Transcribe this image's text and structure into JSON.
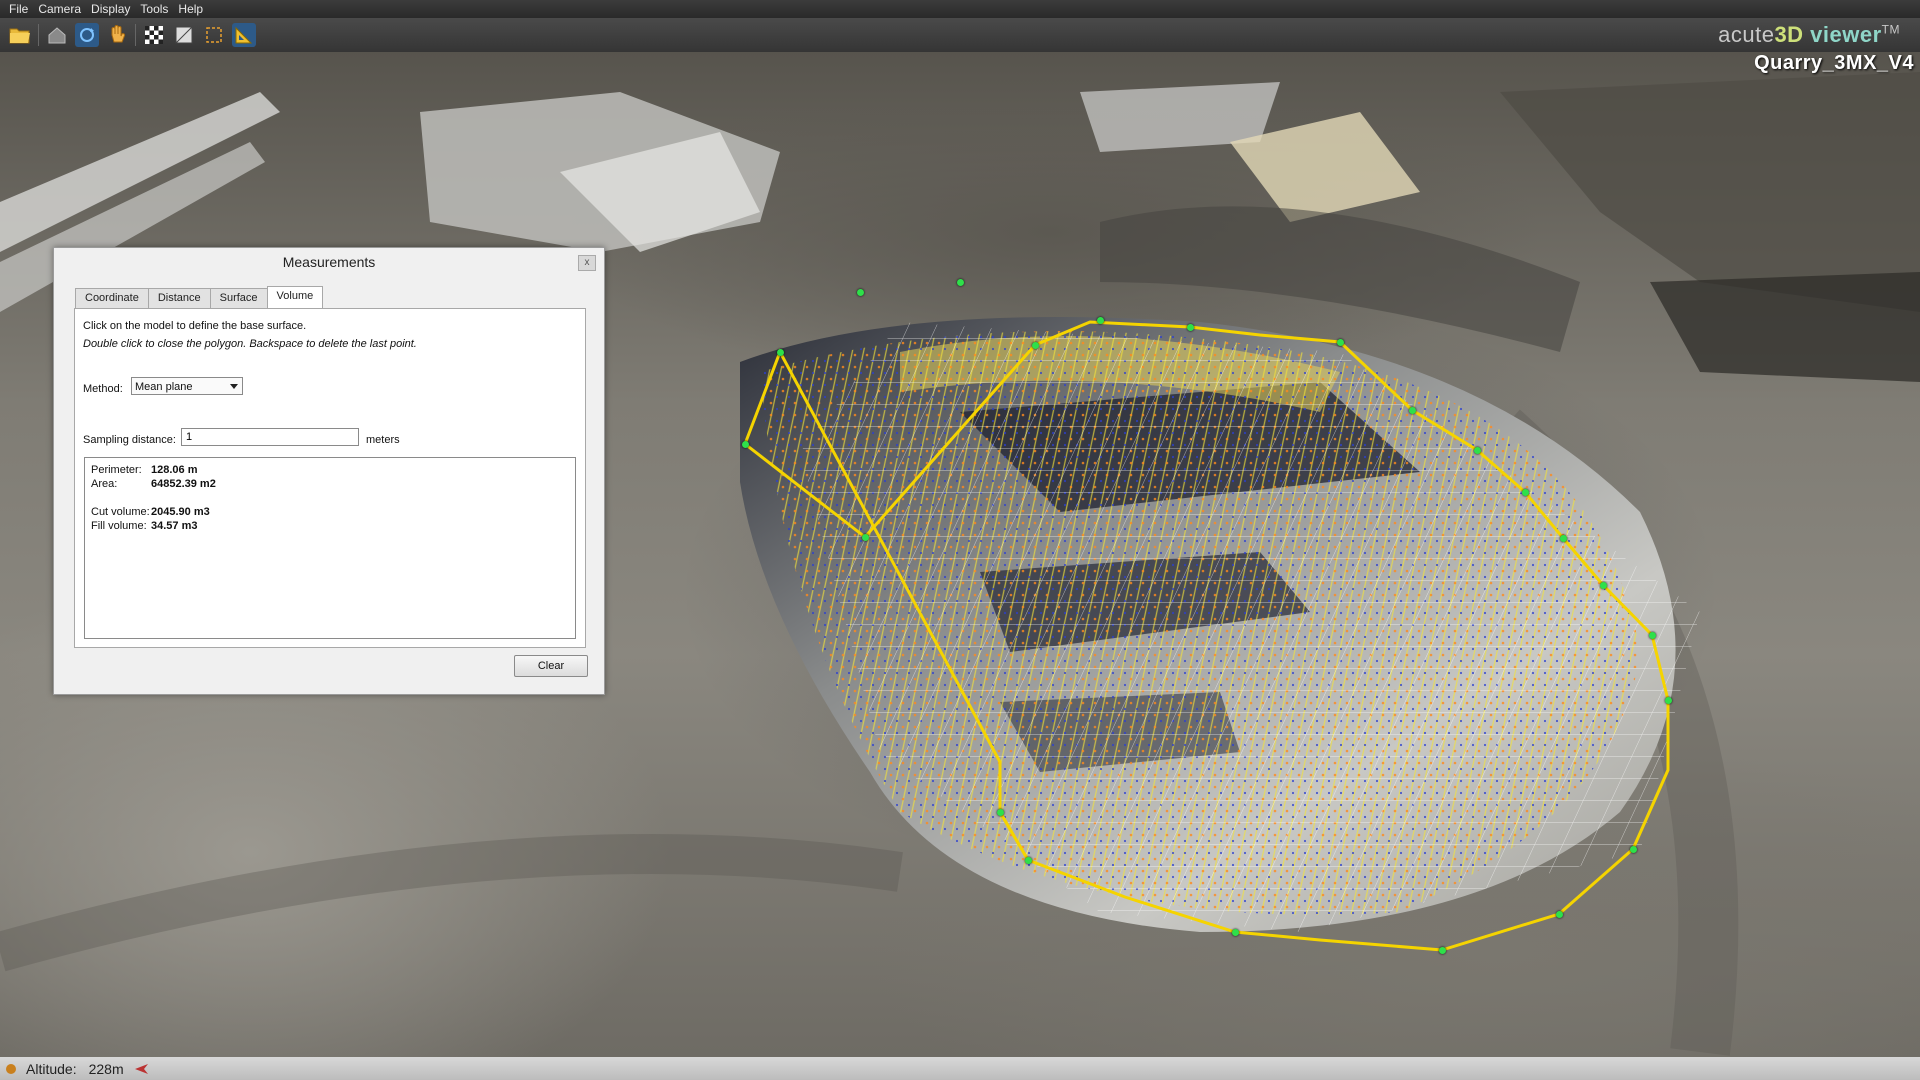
{
  "menu": [
    "File",
    "Camera",
    "Display",
    "Tools",
    "Help"
  ],
  "brand": {
    "prefix": "acute",
    "mid": "3D",
    "suffix": " viewer",
    "tm": "TM"
  },
  "model_title": "Quarry_3MX_V4",
  "dialog": {
    "title": "Measurements",
    "close": "x",
    "tabs": [
      "Coordinate",
      "Distance",
      "Surface",
      "Volume"
    ],
    "selected_tab": "Volume",
    "hint1": "Click on the model to define the base surface.",
    "hint2": "Double click to close the polygon. Backspace to delete the last point.",
    "method_label": "Method:",
    "method_value": "Mean plane",
    "sampling_label": "Sampling distance:",
    "sampling_value": "1",
    "sampling_unit": "meters",
    "results": {
      "perimeter_label": "Perimeter:",
      "perimeter_value": "128.06 m",
      "area_label": "Area:",
      "area_value": "64852.39 m2",
      "cut_label": "Cut volume:",
      "cut_value": "2045.90 m3",
      "fill_label": "Fill volume:",
      "fill_value": "34.57 m3"
    },
    "clear_label": "Clear"
  },
  "status": {
    "altitude_label": "Altitude:",
    "altitude_value": "228m"
  },
  "colors": {
    "polygon": "#f5d400",
    "vertex": "#2ee04a",
    "grid": "#ffffff",
    "accent": "#2d5a88"
  },
  "toolbar_icons": [
    "open-folder-icon",
    "home-icon",
    "orbit-icon",
    "pan-hand-icon",
    "checker-icon",
    "wireframe-icon",
    "select-icon",
    "measure-icon"
  ]
}
